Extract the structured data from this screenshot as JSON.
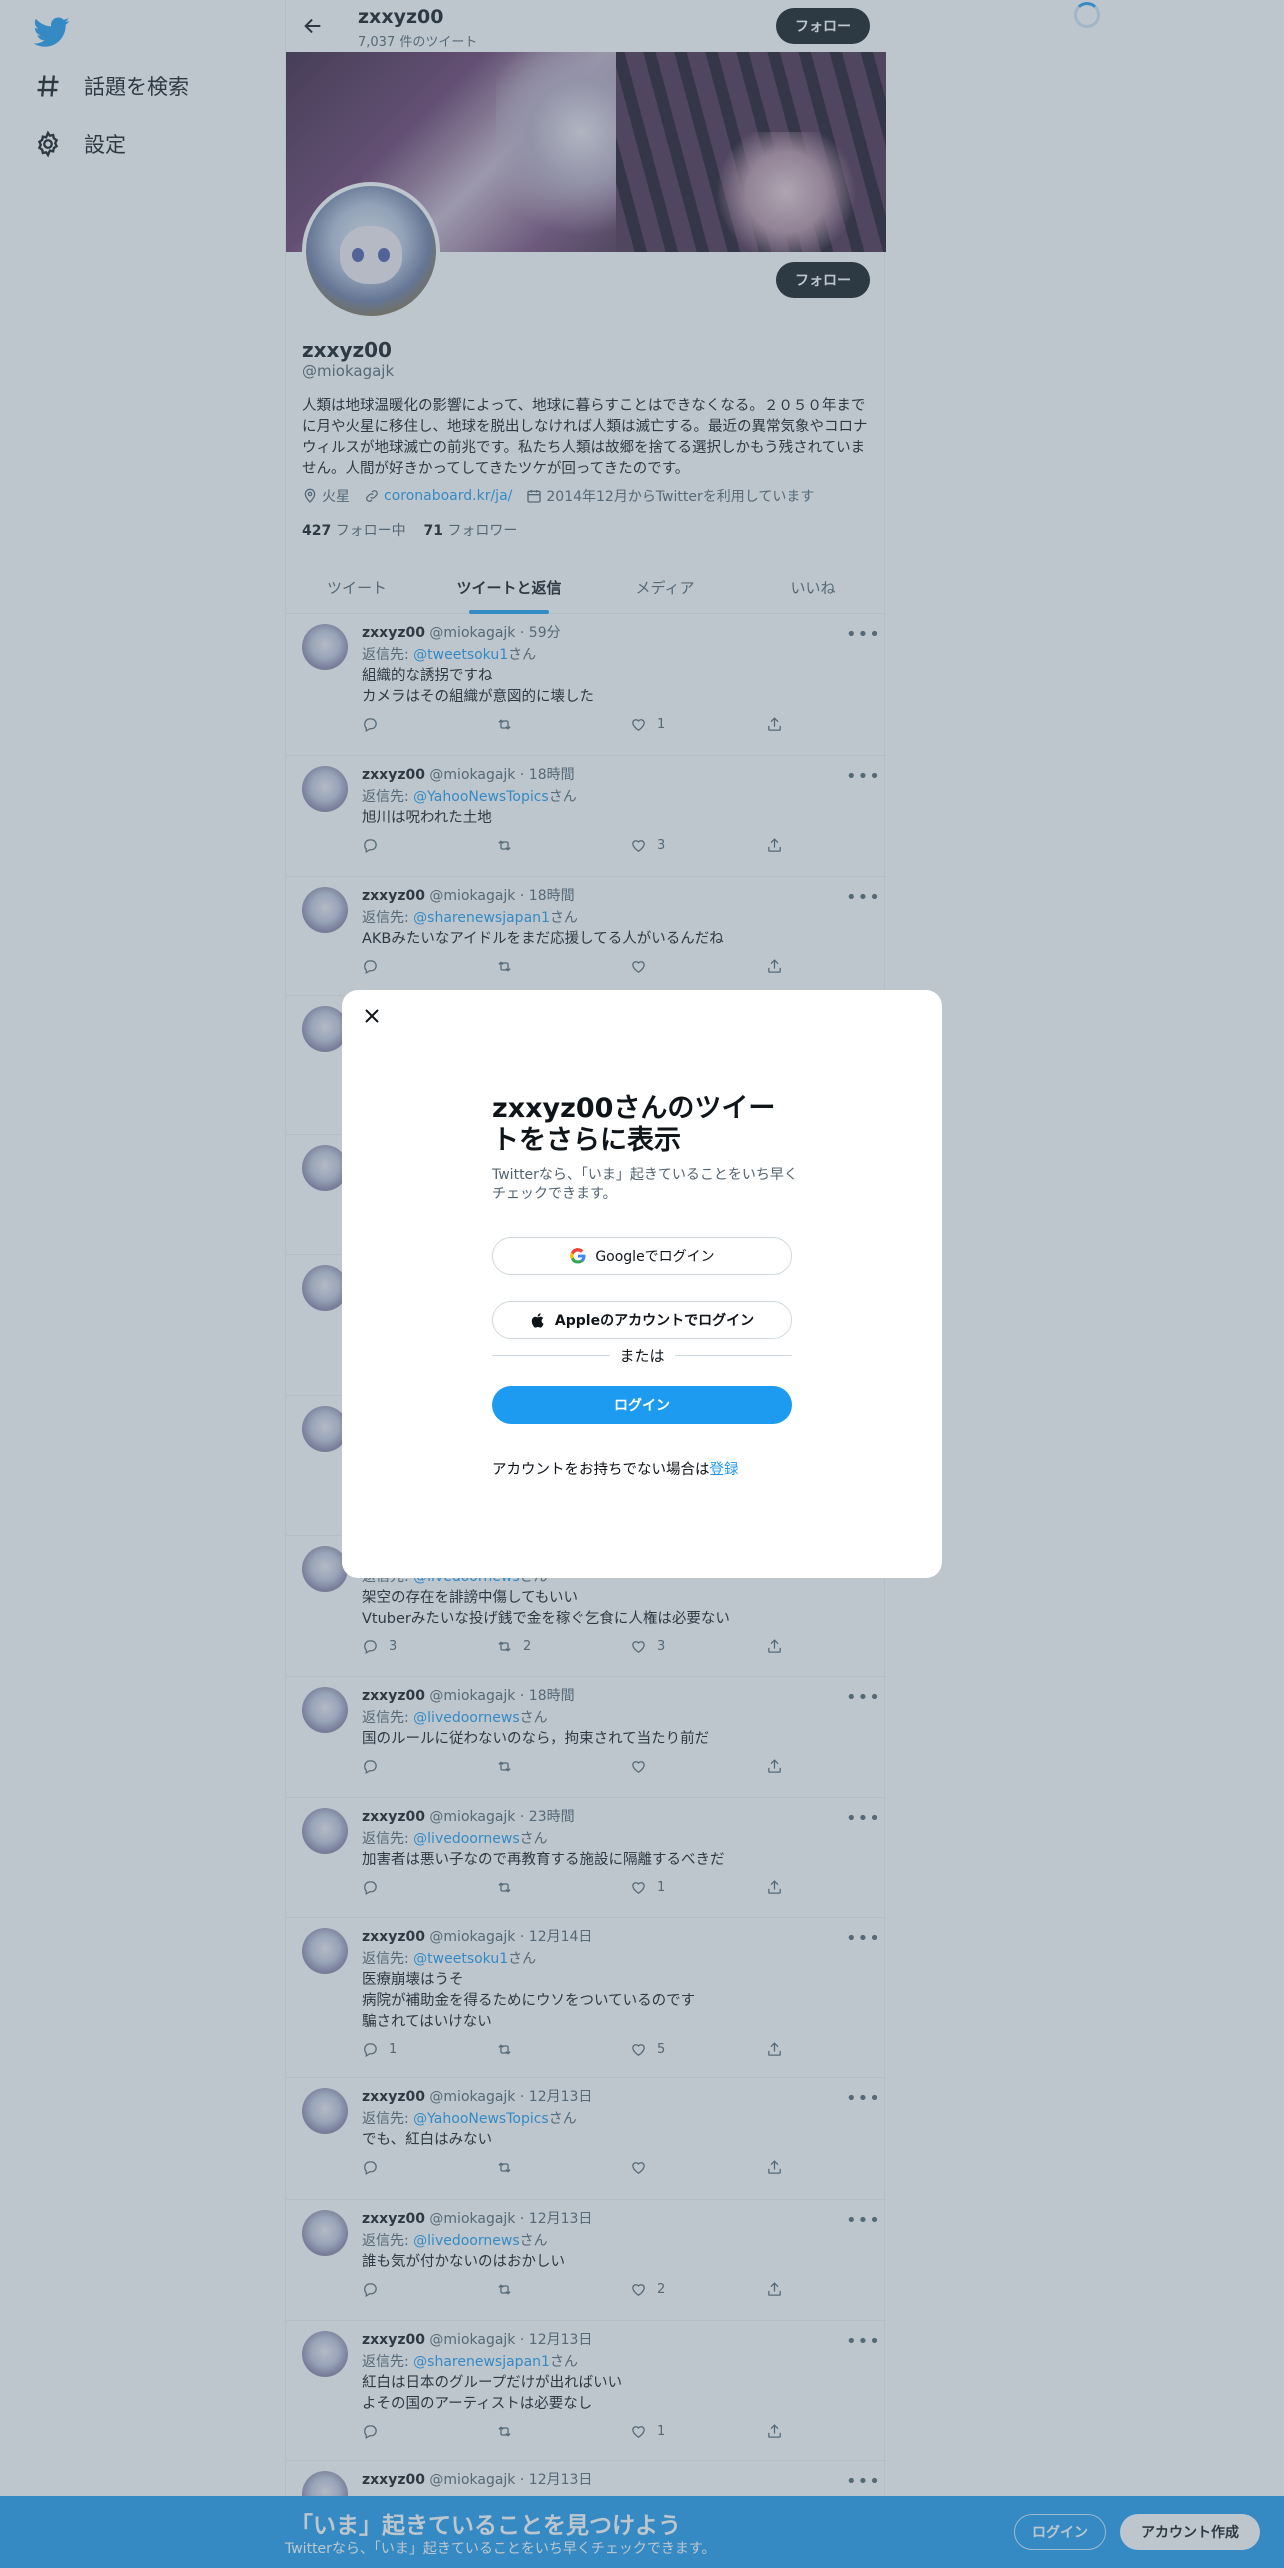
{
  "sidebar": {
    "logo_icon": "twitter-bird-icon",
    "items": [
      {
        "icon": "hashtag-icon",
        "label": "話題を検索"
      },
      {
        "icon": "gear-icon",
        "label": "設定"
      }
    ]
  },
  "header": {
    "name": "zxxyz00",
    "tweet_count": "7,037 件のツイート",
    "follow_label": "フォロー"
  },
  "profile": {
    "name": "zxxyz00",
    "handle": "@miokagajk",
    "follow_label": "フォロー",
    "bio": "人類は地球温暖化の影響によって、地球に暮らすことはできなくなる。２０５０年までに月や火星に移住し、地球を脱出しなければ人類は滅亡する。最近の異常気象やコロナウィルスが地球滅亡の前兆です。私たち人類は故郷を捨てる選択しかもう残されていません。人間が好きかってしてきたツケが回ってきたのです。",
    "location": "火星",
    "url": "coronaboard.kr/ja/",
    "joined": "2014年12月からTwitterを利用しています",
    "following_count": "427",
    "following_label": "フォロー中",
    "followers_count": "71",
    "followers_label": "フォロワー"
  },
  "tabs": [
    "ツイート",
    "ツイートと返信",
    "メディア",
    "いいね"
  ],
  "active_tab": "ツイートと返信",
  "tweets": [
    {
      "name": "zxxyz00",
      "handle": "@miokagajk",
      "time": "59分",
      "reply_prefix": "返信先: ",
      "reply_to": "@tweetsoku1",
      "reply_suffix": "さん",
      "text": "組織的な誘拐ですね\nカメラはその組織が意図的に壊した",
      "replies": "",
      "retweets": "",
      "likes": "1"
    },
    {
      "name": "zxxyz00",
      "handle": "@miokagajk",
      "time": "18時間",
      "reply_prefix": "返信先: ",
      "reply_to": "@YahooNewsTopics",
      "reply_suffix": "さん",
      "text": "旭川は呪われた土地",
      "replies": "",
      "retweets": "",
      "likes": "3"
    },
    {
      "name": "zxxyz00",
      "handle": "@miokagajk",
      "time": "18時間",
      "reply_prefix": "返信先: ",
      "reply_to": "@sharenewsjapan1",
      "reply_suffix": "さん",
      "text": "AKBみたいなアイドルをまだ応援してる人がいるんだね",
      "replies": "",
      "retweets": "",
      "likes": ""
    },
    {
      "name": "",
      "handle": "",
      "time": "",
      "reply_prefix": "",
      "reply_to": "",
      "reply_suffix": "",
      "text": "",
      "replies": "",
      "retweets": "",
      "likes": ""
    },
    {
      "name": "",
      "handle": "",
      "time": "",
      "reply_prefix": "",
      "reply_to": "",
      "reply_suffix": "",
      "text": "",
      "replies": "",
      "retweets": "",
      "likes": ""
    },
    {
      "name": "",
      "handle": "",
      "time": "",
      "reply_prefix": "",
      "reply_to": "",
      "reply_suffix": "",
      "text": "",
      "replies": "",
      "retweets": "",
      "likes": ""
    },
    {
      "name": "",
      "handle": "",
      "time": "",
      "reply_prefix": "",
      "reply_to": "",
      "reply_suffix": "",
      "text": "",
      "replies": "",
      "retweets": "",
      "likes": ""
    },
    {
      "name": "",
      "handle": "",
      "time": "",
      "reply_prefix": "返信先: ",
      "reply_to": "@livedoornews",
      "reply_suffix": "さん",
      "text": "架空の存在を誹謗中傷してもいい\nVtuberみたいな投げ銭で金を稼ぐ乞食に人権は必要ない",
      "replies": "3",
      "retweets": "2",
      "likes": "3"
    },
    {
      "name": "zxxyz00",
      "handle": "@miokagajk",
      "time": "18時間",
      "reply_prefix": "返信先: ",
      "reply_to": "@livedoornews",
      "reply_suffix": "さん",
      "text": "国のルールに従わないのなら，拘束されて当たり前だ",
      "replies": "",
      "retweets": "",
      "likes": ""
    },
    {
      "name": "zxxyz00",
      "handle": "@miokagajk",
      "time": "23時間",
      "reply_prefix": "返信先: ",
      "reply_to": "@livedoornews",
      "reply_suffix": "さん",
      "text": "加害者は悪い子なので再教育する施設に隔離するべきだ",
      "replies": "",
      "retweets": "",
      "likes": "1"
    },
    {
      "name": "zxxyz00",
      "handle": "@miokagajk",
      "time": "12月14日",
      "reply_prefix": "返信先: ",
      "reply_to": "@tweetsoku1",
      "reply_suffix": "さん",
      "text": "医療崩壊はうそ\n病院が補助金を得るためにウソをついているのです\n騙されてはいけない",
      "replies": "1",
      "retweets": "",
      "likes": "5"
    },
    {
      "name": "zxxyz00",
      "handle": "@miokagajk",
      "time": "12月13日",
      "reply_prefix": "返信先: ",
      "reply_to": "@YahooNewsTopics",
      "reply_suffix": "さん",
      "text": "でも、紅白はみない",
      "replies": "",
      "retweets": "",
      "likes": ""
    },
    {
      "name": "zxxyz00",
      "handle": "@miokagajk",
      "time": "12月13日",
      "reply_prefix": "返信先: ",
      "reply_to": "@livedoornews",
      "reply_suffix": "さん",
      "text": "誰も気が付かないのはおかしい",
      "replies": "",
      "retweets": "",
      "likes": "2"
    },
    {
      "name": "zxxyz00",
      "handle": "@miokagajk",
      "time": "12月13日",
      "reply_prefix": "返信先: ",
      "reply_to": "@sharenewsjapan1",
      "reply_suffix": "さん",
      "text": "紅白は日本のグループだけが出ればいい\nよその国のアーティストは必要なし",
      "replies": "",
      "retweets": "",
      "likes": "1"
    },
    {
      "name": "zxxyz00",
      "handle": "@miokagajk",
      "time": "12月13日",
      "reply_prefix": "",
      "reply_to": "",
      "reply_suffix": "",
      "text": "",
      "replies": "",
      "retweets": "",
      "likes": ""
    }
  ],
  "modal": {
    "title": "zxxyz00さんのツイートをさらに表示",
    "subtitle": "Twitterなら、「いま」起きていることをいち早くチェックできます。",
    "google_label": "Googleでログイン",
    "apple_label": "Appleのアカウントでログイン",
    "or_label": "または",
    "login_label": "ログイン",
    "signup_prefix": "アカウントをお持ちでない場合は",
    "signup_link": "登録"
  },
  "bottom_bar": {
    "title": "「いま」起きていることを見つけよう",
    "subtitle": "Twitterなら、「いま」起きていることをいち早くチェックできます。",
    "login_label": "ログイン",
    "signup_label": "アカウント作成"
  },
  "colors": {
    "accent": "#1d9bf0",
    "text": "#0f1419",
    "secondary": "#536471"
  }
}
